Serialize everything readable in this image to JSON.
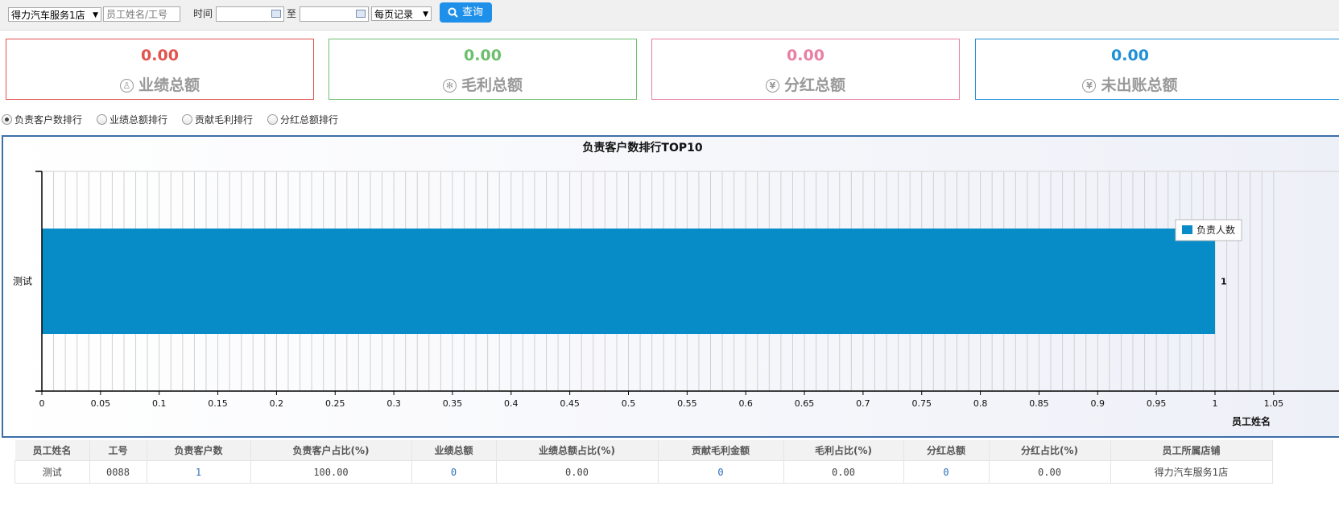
{
  "toolbar": {
    "store_select": "得力汽车服务1店",
    "employee_placeholder": "员工姓名/工号",
    "time_label": "时间",
    "to_label": "至",
    "start_date": "",
    "end_date": "",
    "page_size_select": "每页记录",
    "query_button": "查询"
  },
  "cards": [
    {
      "value": "0.00",
      "label": "业绩总额",
      "icon": "person-circle-icon",
      "color": "#e2534f"
    },
    {
      "value": "0.00",
      "label": "毛利总额",
      "icon": "gear-circle-icon",
      "color": "#6dbf6d"
    },
    {
      "value": "0.00",
      "label": "分红总额",
      "icon": "yen-circle-icon",
      "color": "#e97fa4"
    },
    {
      "value": "0.00",
      "label": "未出账总额",
      "icon": "yen-circle-icon",
      "color": "#1e90d8"
    }
  ],
  "ranking_options": [
    {
      "label": "负责客户数排行",
      "selected": true
    },
    {
      "label": "业绩总额排行",
      "selected": false
    },
    {
      "label": "贡献毛利排行",
      "selected": false
    },
    {
      "label": "分红总额排行",
      "selected": false
    }
  ],
  "chart_data": {
    "type": "bar",
    "orientation": "horizontal",
    "title": "负责客户数排行TOP10",
    "categories": [
      "测试"
    ],
    "series": [
      {
        "name": "负责人数",
        "values": [
          1
        ],
        "color": "#088cc8"
      }
    ],
    "xlim": [
      0,
      1.05
    ],
    "x_ticks": [
      "0",
      "0.05",
      "0.1",
      "0.15",
      "0.2",
      "0.25",
      "0.3",
      "0.35",
      "0.4",
      "0.45",
      "0.5",
      "0.55",
      "0.6",
      "0.65",
      "0.7",
      "0.75",
      "0.8",
      "0.85",
      "0.9",
      "0.95",
      "1",
      "1.05"
    ],
    "x_tick_values": [
      0,
      0.05,
      0.1,
      0.15,
      0.2,
      0.25,
      0.3,
      0.35,
      0.4,
      0.45,
      0.5,
      0.55,
      0.6,
      0.65,
      0.7,
      0.75,
      0.8,
      0.85,
      0.9,
      0.95,
      1,
      1.05
    ],
    "data_labels": [
      "1"
    ],
    "axis_corner_label": "员工姓名",
    "legend_position": "right",
    "grid": true
  },
  "table": {
    "headers": [
      "员工姓名",
      "工号",
      "负责客户数",
      "负责客户占比(%)",
      "业绩总额",
      "业绩总额占比(%)",
      "贡献毛利金额",
      "毛利占比(%)",
      "分红总额",
      "分红占比(%)",
      "员工所属店铺"
    ],
    "rows": [
      [
        "测试",
        "0088",
        "1",
        "100.00",
        "0",
        "0.00",
        "0",
        "0.00",
        "0",
        "0.00",
        "得力汽车服务1店"
      ]
    ]
  }
}
